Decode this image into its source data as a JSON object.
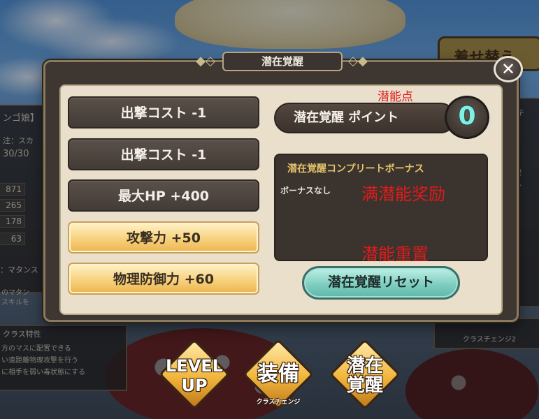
{
  "background": {
    "left_panel": {
      "title": "ンゴ娘】",
      "type_line": "注：スカ",
      "hp": "30/30",
      "stats": [
        "871",
        "265",
        "178",
        "63"
      ],
      "skill_label": "：マタンス",
      "desc_1": "のマタン",
      "desc_2": "スキルを"
    },
    "class_panel": {
      "title": "クラス特性",
      "lines": [
        "方のマスに配置できる",
        "い遠距離物理攻撃を行う",
        "に相手を弱い毒状態にする"
      ]
    },
    "right_top_button": "着せ替え",
    "right_panel": {
      "lines": [
        "スキ",
        "射程",
        "ゲン"
      ]
    },
    "right_bottom": "クラスチェンジ2"
  },
  "dialog": {
    "title": "潜在覚醒",
    "close_icon": "close-x-icon",
    "stats": [
      {
        "label": "出撃コスト -1",
        "style": "dark"
      },
      {
        "label": "出撃コスト -1",
        "style": "dark"
      },
      {
        "label": "最大HP +400",
        "style": "dark"
      },
      {
        "label": "攻撃力 +50",
        "style": "gold"
      },
      {
        "label": "物理防御力 +60",
        "style": "gold"
      }
    ],
    "points_label": "潜在覚醒 ポイント",
    "points_value": "0",
    "bonus_title": "潜在覚醒コンプリートボーナス",
    "bonus_none": "ボーナスなし",
    "reset_label": "潜在覚醒リセット"
  },
  "annotations": {
    "points": "潜能点",
    "bonus": "满潜能奖励",
    "reset": "潜能重置",
    "color": "#e01b1b"
  },
  "nav": [
    {
      "label": "LEVEL\nUP",
      "sub": ""
    },
    {
      "label": "装備",
      "sub": "クラスチェンジ"
    },
    {
      "label": "潜在\n覚醒",
      "sub": ""
    }
  ]
}
